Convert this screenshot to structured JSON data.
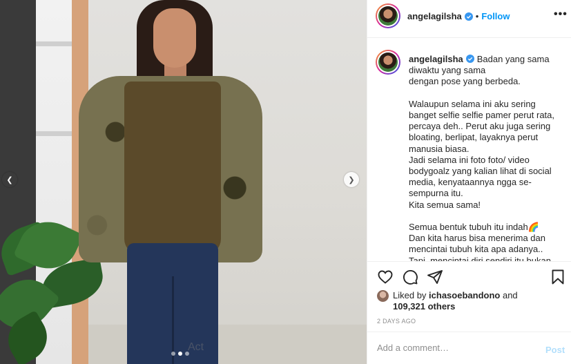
{
  "post": {
    "username": "angelagilsha",
    "separator": "•",
    "follow_label": "Follow",
    "more_label": "•••",
    "verified_icon": "verified-badge-icon",
    "caption_text": "Badan yang sama diwaktu yang sama\ndengan pose yang berbeda.\n\nWalaupun selama ini aku sering banget selfie selfie pamer perut rata, percaya deh.. Perut aku juga sering bloating, berlipat, layaknya perut manusia biasa.\nJadi selama ini foto foto/ video bodygoalz yang kalian lihat di social media, kenyataannya ngga se-sempurna itu.\nKita semua sama!\n\nSemua bentuk tubuh itu indah🌈\nDan kita harus bisa menerima dan mencintai tubuh kita apa adanya..\nTapi, mencintai diri sendiri itu bukan",
    "carousel_dots": 3,
    "active_dot": 1
  },
  "actions": {
    "like_icon": "heart-icon",
    "comment_icon": "comment-icon",
    "share_icon": "share-icon",
    "save_icon": "bookmark-icon"
  },
  "likes": {
    "prefix": "Liked by",
    "user": "ichasoebandono",
    "and": "and",
    "count": "109,321 others"
  },
  "timestamp": "2 DAYS AGO",
  "comment": {
    "placeholder": "Add a comment…",
    "post_label": "Post"
  },
  "watermark": "Act",
  "colors": {
    "accent": "#0095f6",
    "post_disabled": "#b2dffc",
    "muted": "#8e8e8e",
    "text": "#262626"
  }
}
